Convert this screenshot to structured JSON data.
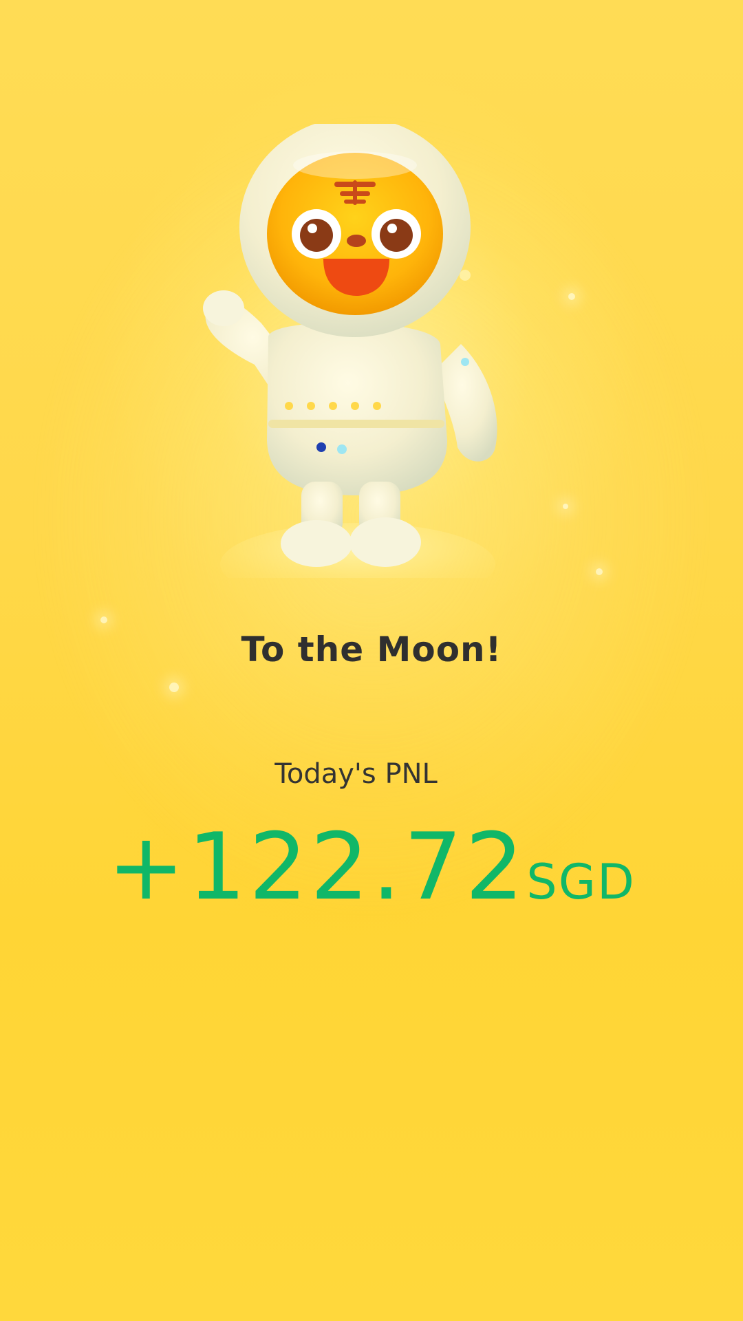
{
  "card": {
    "headline": "To the Moon!",
    "pnl_label": "Today's PNL",
    "pnl_amount": "+122.72",
    "pnl_currency": "SGD"
  },
  "colors": {
    "background": "#ffd84a",
    "headline": "#2f2f2f",
    "pnl_positive": "#10b768"
  },
  "illustration": {
    "icon": "tiger-astronaut-mascot-illustration"
  }
}
